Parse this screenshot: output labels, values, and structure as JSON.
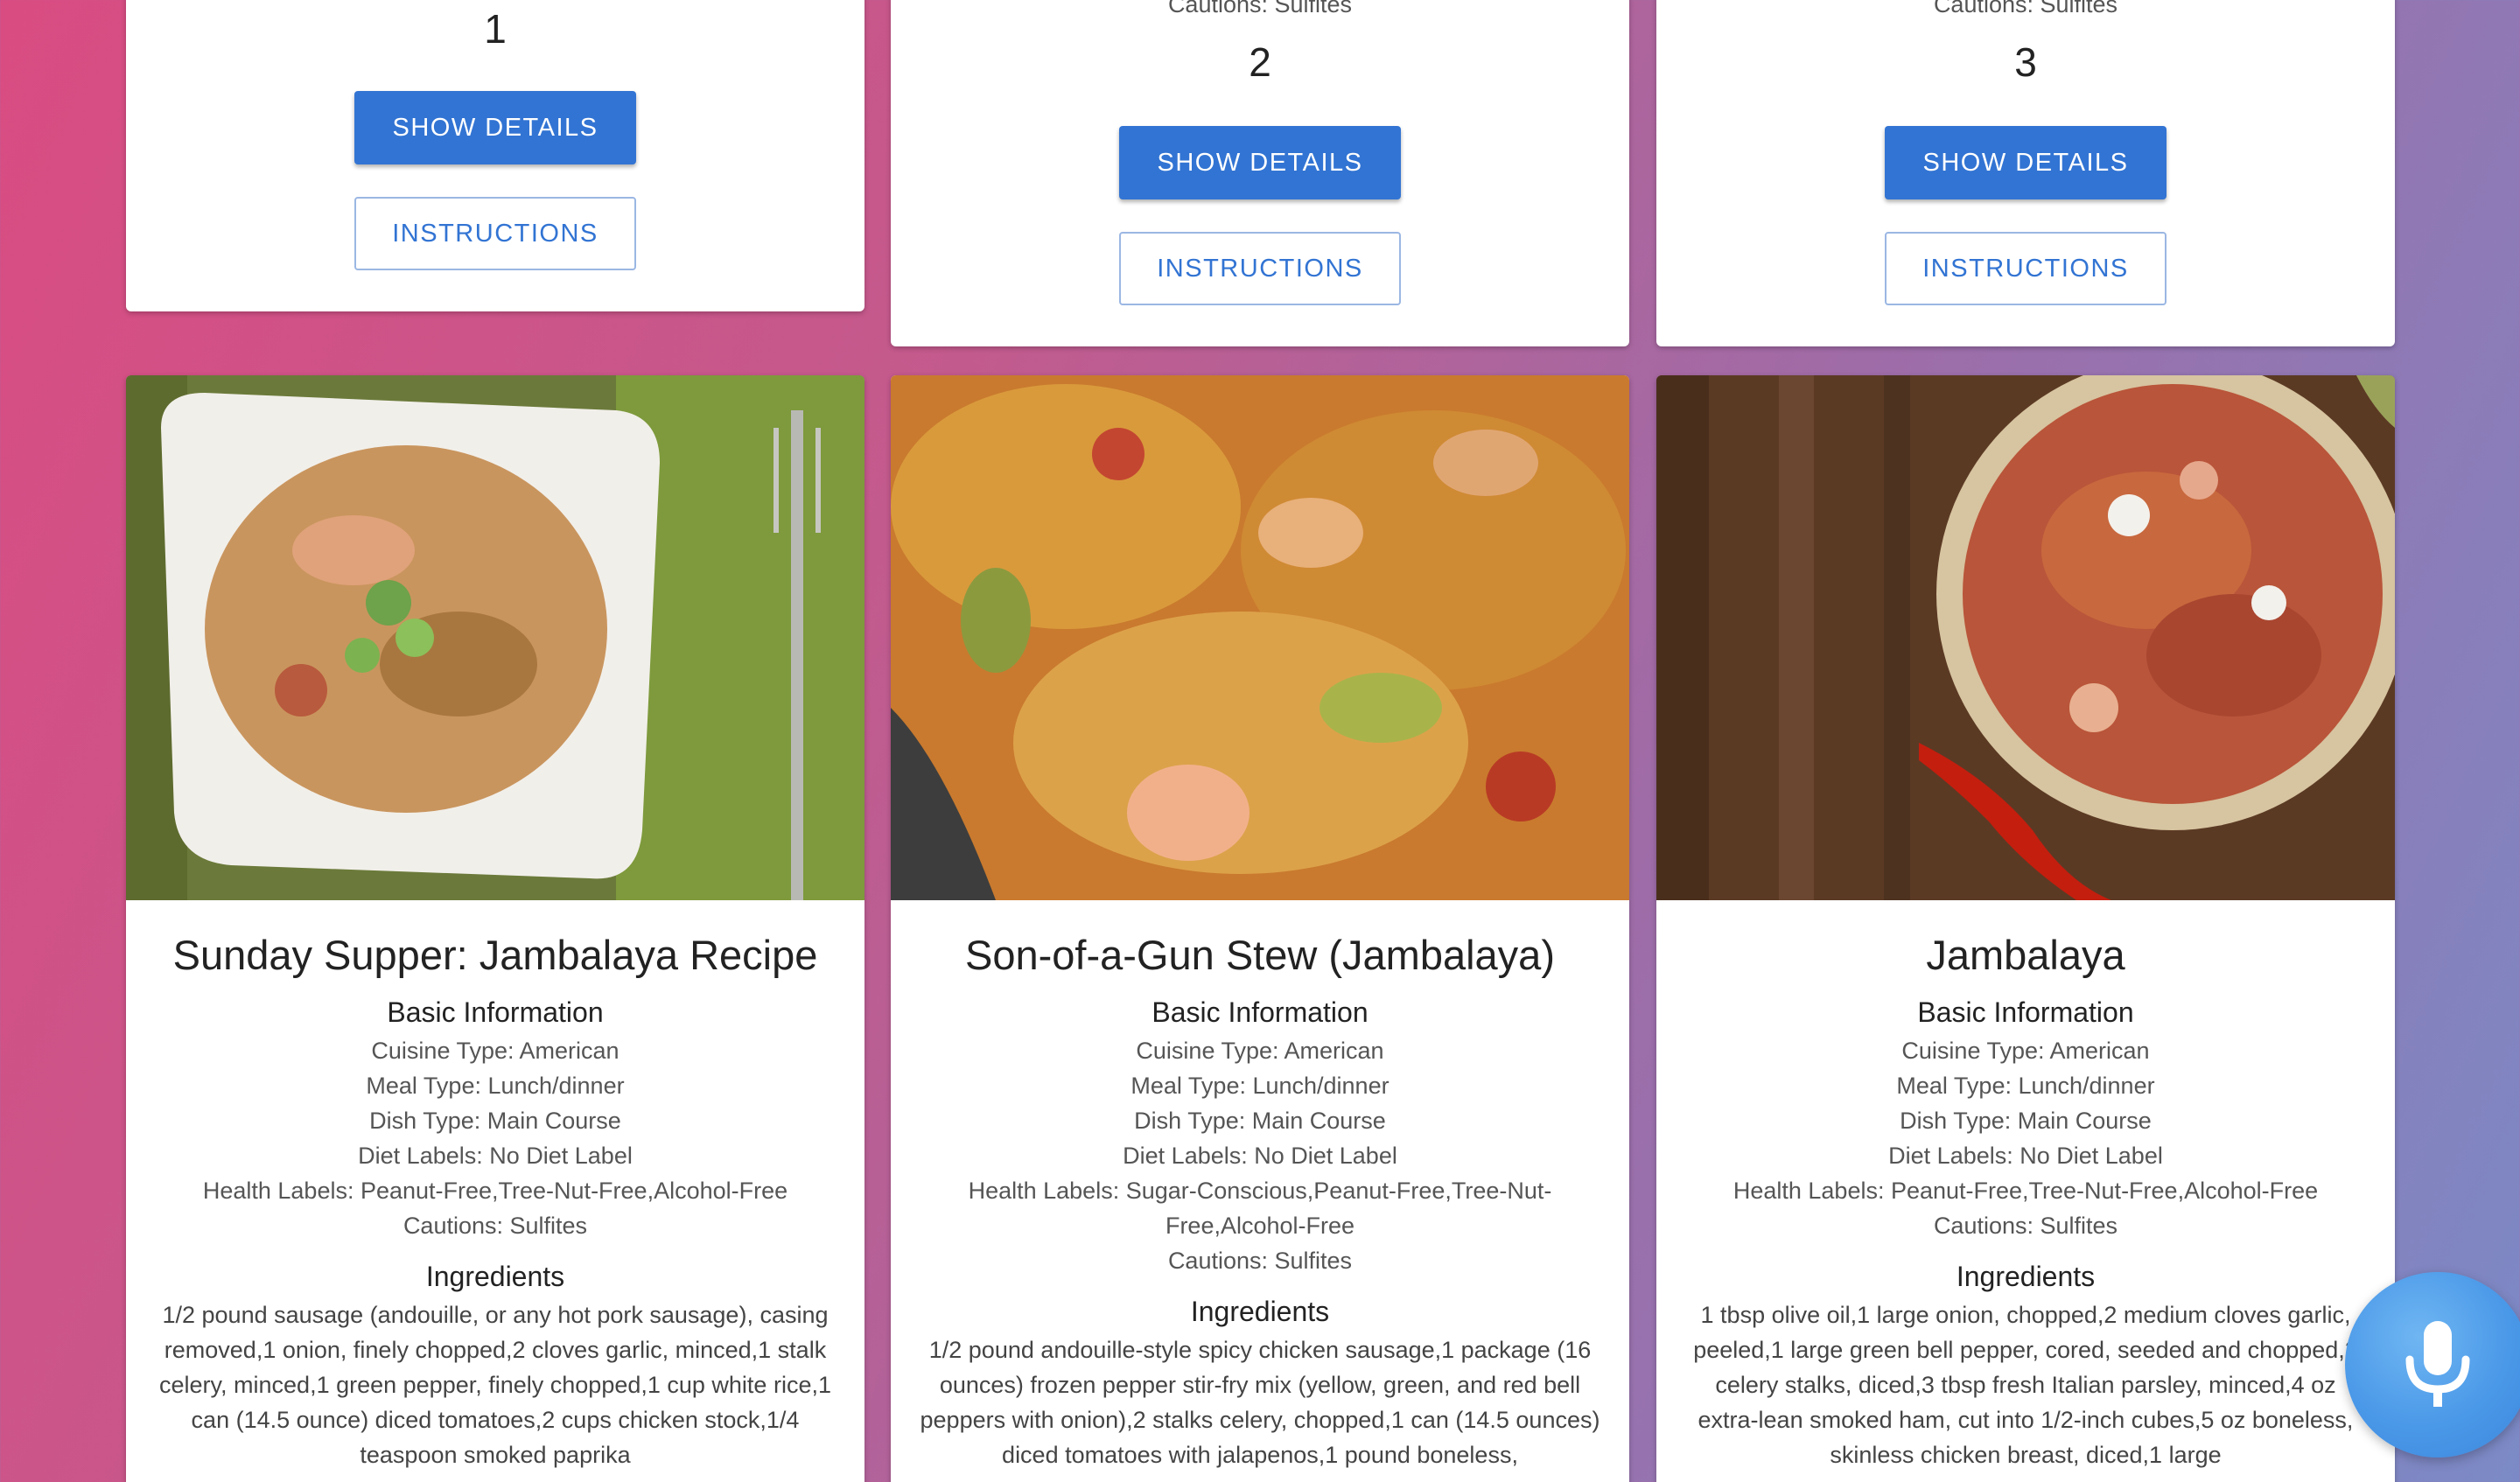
{
  "top_cards": [
    {
      "caution": "",
      "number": "1",
      "show_details": "SHOW DETAILS",
      "instructions": "INSTRUCTIONS"
    },
    {
      "caution": "Cautions: Sulfites",
      "number": "2",
      "show_details": "SHOW DETAILS",
      "instructions": "INSTRUCTIONS"
    },
    {
      "caution": "Cautions: Sulfites",
      "number": "3",
      "show_details": "SHOW DETAILS",
      "instructions": "INSTRUCTIONS"
    }
  ],
  "recipes": [
    {
      "title": "Sunday Supper: Jambalaya Recipe",
      "basic_heading": "Basic Information",
      "cuisine": "Cuisine Type: American",
      "meal": "Meal Type: Lunch/dinner",
      "dish": "Dish Type: Main Course",
      "diet": "Diet Labels: No Diet Label",
      "health": "Health Labels: Peanut-Free,Tree-Nut-Free,Alcohol-Free",
      "cautions": "Cautions: Sulfites",
      "ingredients_heading": "Ingredients",
      "ingredients": "1/2 pound sausage (andouille, or any hot pork sausage), casing removed,1 onion, finely chopped,2 cloves garlic, minced,1 stalk celery, minced,1 green pepper, finely chopped,1 cup white rice,1 can (14.5 ounce) diced tomatoes,2 cups chicken stock,1/4 teaspoon smoked paprika"
    },
    {
      "title": "Son-of-a-Gun Stew (Jambalaya)",
      "basic_heading": "Basic Information",
      "cuisine": "Cuisine Type: American",
      "meal": "Meal Type: Lunch/dinner",
      "dish": "Dish Type: Main Course",
      "diet": "Diet Labels: No Diet Label",
      "health": "Health Labels: Sugar-Conscious,Peanut-Free,Tree-Nut-Free,Alcohol-Free",
      "cautions": "Cautions: Sulfites",
      "ingredients_heading": "Ingredients",
      "ingredients": "1/2 pound andouille-style spicy chicken sausage,1 package (16 ounces) frozen pepper stir-fry mix (yellow, green, and red bell peppers with onion),2 stalks celery, chopped,1 can (14.5 ounces) diced tomatoes with jalapenos,1 pound boneless,"
    },
    {
      "title": "Jambalaya",
      "basic_heading": "Basic Information",
      "cuisine": "Cuisine Type: American",
      "meal": "Meal Type: Lunch/dinner",
      "dish": "Dish Type: Main Course",
      "diet": "Diet Labels: No Diet Label",
      "health": "Health Labels: Peanut-Free,Tree-Nut-Free,Alcohol-Free",
      "cautions": "Cautions: Sulfites",
      "ingredients_heading": "Ingredients",
      "ingredients": "1 tbsp olive oil,1 large onion, chopped,2 medium cloves garlic, peeled,1 large green bell pepper, cored, seeded and chopped,2 celery stalks, diced,3 tbsp fresh Italian parsley, minced,4 oz extra-lean smoked ham, cut into 1/2-inch cubes,5 oz boneless, skinless chicken breast, diced,1 large"
    }
  ],
  "mic": {
    "icon": "microphone-icon"
  },
  "colors": {
    "primary": "#3274d3",
    "mic": "#4a98e8"
  }
}
